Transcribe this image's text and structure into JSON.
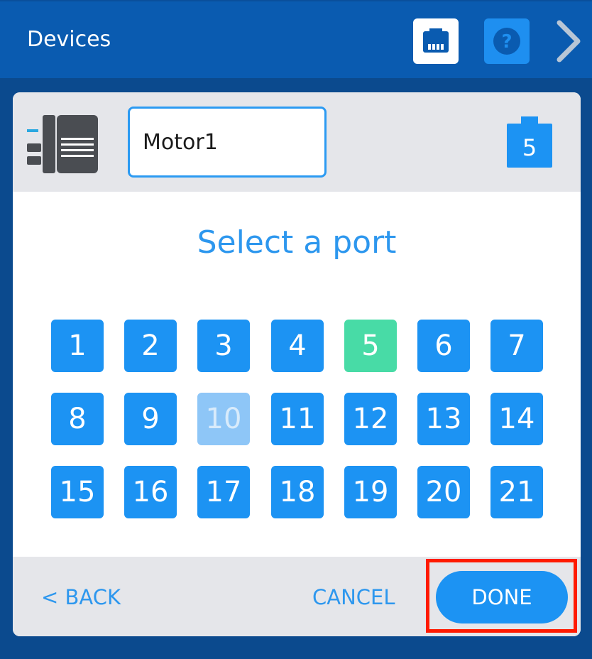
{
  "header": {
    "title": "Devices",
    "port_icon": "ethernet-port-icon",
    "help_label": "?",
    "next_icon": "chevron-right-icon"
  },
  "device": {
    "icon": "motor-device-icon",
    "name_value": "Motor1",
    "current_port": "5"
  },
  "selector": {
    "title": "Select a port",
    "ports": [
      "1",
      "2",
      "3",
      "4",
      "5",
      "6",
      "7",
      "8",
      "9",
      "10",
      "11",
      "12",
      "13",
      "14",
      "15",
      "16",
      "17",
      "18",
      "19",
      "20",
      "21"
    ],
    "selected_port": "5",
    "disabled_ports": [
      "10"
    ]
  },
  "footer": {
    "back_label": "< BACK",
    "cancel_label": "CANCEL",
    "done_label": "DONE"
  },
  "colors": {
    "accent": "#1c93f3",
    "selected": "#48dba6",
    "disabled": "#8ec6f7",
    "highlight": "#ff1a00",
    "topbar": "#0a5bb0"
  }
}
